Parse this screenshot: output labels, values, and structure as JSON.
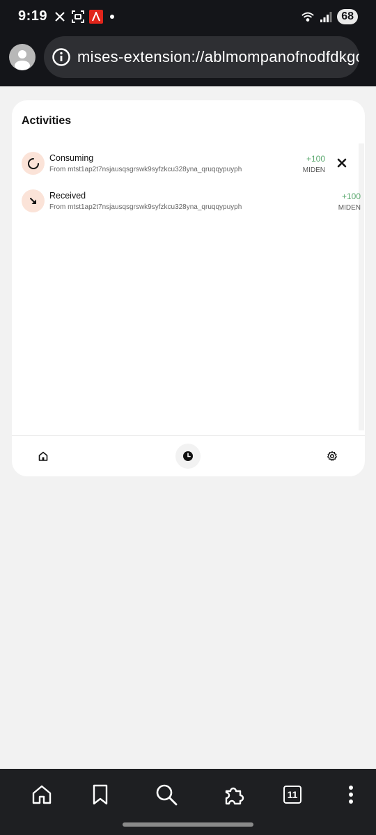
{
  "status_bar": {
    "time": "9:19",
    "battery": "68",
    "icons": [
      "x-logo-icon",
      "screenshot-icon",
      "adobe-icon",
      "notification-dot",
      "wifi-icon",
      "signal-icon",
      "battery-icon"
    ]
  },
  "browser": {
    "url": "mises-extension://ablmompanofnodfdkgc",
    "icons": [
      "profile-avatar-icon",
      "site-info-icon"
    ]
  },
  "card": {
    "title": "Activities",
    "activities": [
      {
        "title": "Consuming",
        "subtitle": "From mtst1ap2t7nsjausqsgrswk9syfzkcu328yna_qruqqypuyph",
        "amount": "+100",
        "unit": "MIDEN",
        "icon": "spinner-icon"
      },
      {
        "title": "Received",
        "subtitle": "From mtst1ap2t7nsjausqsgrswk9syfzkcu328yna_qruqqypuyph",
        "amount": "+100",
        "unit": "MIDEN",
        "icon": "arrow-down-right-icon"
      }
    ],
    "nav": [
      {
        "name": "home",
        "icon": "home-icon",
        "active": false
      },
      {
        "name": "history",
        "icon": "clock-icon",
        "active": true
      },
      {
        "name": "settings",
        "icon": "gear-icon",
        "active": false
      }
    ]
  },
  "bottom_bar": {
    "tab_count": "11",
    "icons": [
      "home-icon",
      "bookmark-icon",
      "search-icon",
      "extensions-icon",
      "tabs-icon",
      "more-icon"
    ]
  },
  "colors": {
    "amount_green": "#5aa86e",
    "activity_icon_bg": "#fbe3d8",
    "system_bar": "#141519"
  }
}
